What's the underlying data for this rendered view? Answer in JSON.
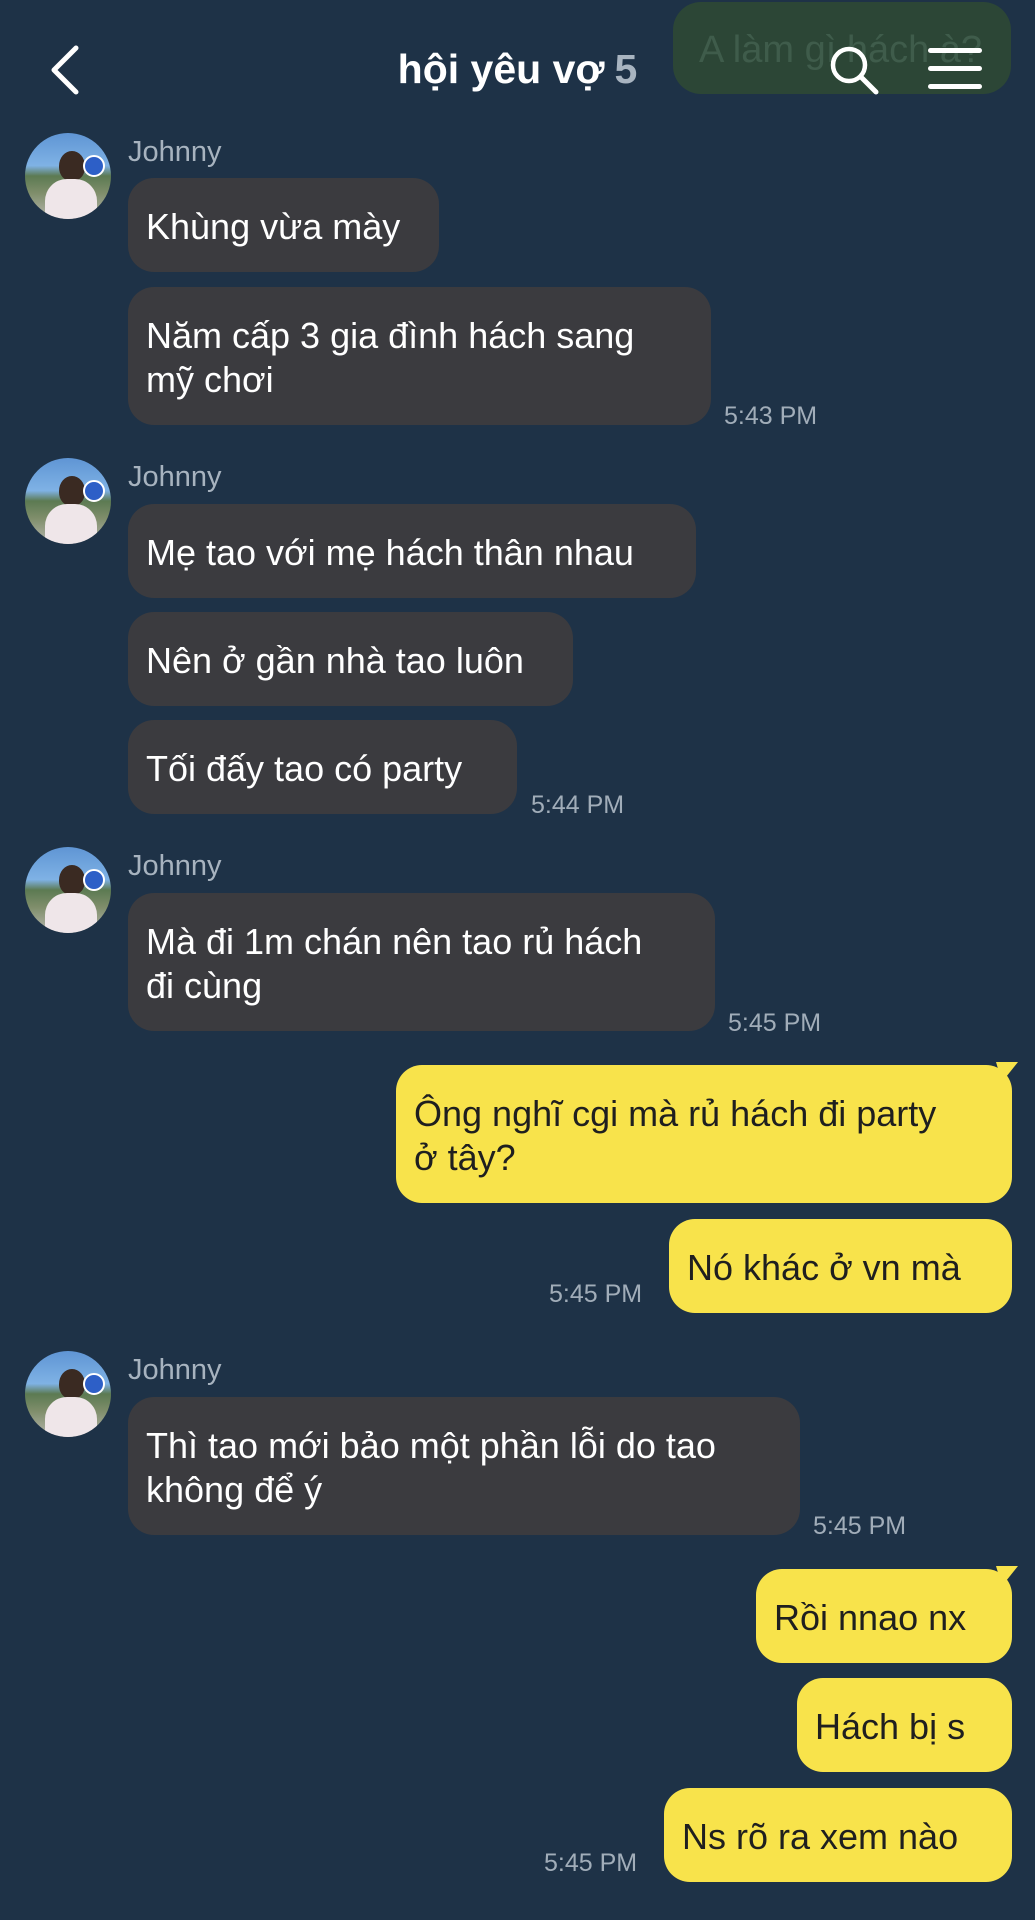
{
  "header": {
    "title": "hội yêu vợ",
    "member_count": "5",
    "ghost_text": "A làm gì hách à?"
  },
  "messages": {
    "m1": {
      "sender": "Johnny",
      "b1": "Khùng vừa mày",
      "b2": "Năm cấp 3 gia đình hách sang\nmỹ chơi",
      "time": "5:43 PM"
    },
    "m2": {
      "sender": "Johnny",
      "b1": "Mẹ tao với mẹ hách thân nhau",
      "b2": "Nên ở gần nhà tao luôn",
      "b3": "Tối đấy tao có party",
      "time": "5:44 PM"
    },
    "m3": {
      "sender": "Johnny",
      "b1": "Mà đi 1m chán nên tao rủ hách\nđi cùng",
      "time": "5:45 PM"
    },
    "m4": {
      "b1": "Ông nghĩ cgi mà rủ hách đi party\nở tây?",
      "b2": "Nó khác ở vn mà",
      "time": "5:45 PM"
    },
    "m5": {
      "sender": "Johnny",
      "b1": "Thì tao mới bảo một phần lỗi do tao\nkhông để ý",
      "time": "5:45 PM"
    },
    "m6": {
      "b1": "Rồi nnao nx",
      "b2": "Hách bị s",
      "b3": "Ns rõ ra xem nào",
      "time": "5:45 PM"
    }
  },
  "colors": {
    "background": "#1e3247",
    "incoming_bubble": "#3b3b3f",
    "outgoing_bubble": "#f8e34b"
  },
  "icons": [
    "back-arrow-icon",
    "search-icon",
    "menu-icon"
  ]
}
